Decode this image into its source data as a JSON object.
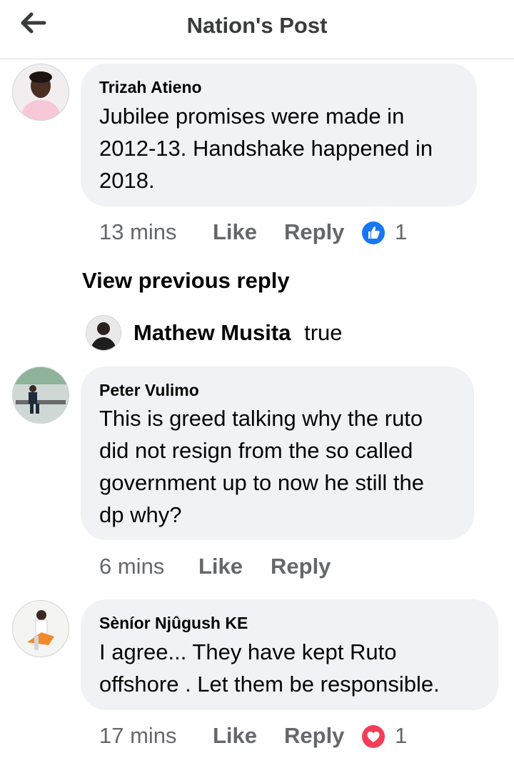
{
  "header": {
    "title": "Nation's Post",
    "back_icon": "arrow-left-icon"
  },
  "comments": [
    {
      "author": "Trizah Atieno",
      "lines": [
        "Jubilee promises were made in",
        "2012-13. Handshake happened in",
        "2018."
      ],
      "time": "13 mins",
      "like_label": "Like",
      "reply_label": "Reply",
      "reaction": {
        "icon": "thumbs-up-icon",
        "color": "#1877f2",
        "count": "1"
      },
      "avatar_icon": "profile-photo"
    },
    {
      "author": "Peter Vulimo",
      "lines": [
        "This is greed talking why the ruto",
        "did not resign from the so called",
        "government up to now he still the",
        "dp why?"
      ],
      "time": "6 mins",
      "like_label": "Like",
      "reply_label": "Reply",
      "avatar_icon": "profile-photo"
    },
    {
      "author": "Sèníor Njûgush KE",
      "lines": [
        "I agree... They have kept Ruto",
        "offshore . Let them be responsible."
      ],
      "time": "17 mins",
      "like_label": "Like",
      "reply_label": "Reply",
      "reaction": {
        "icon": "heart-icon",
        "color": "#f33e58",
        "count": "1"
      },
      "avatar_icon": "profile-photo"
    }
  ],
  "replies": {
    "view_previous_label": "View previous reply",
    "latest": {
      "author": "Mathew Musita",
      "text": "true"
    }
  },
  "colors": {
    "bubble": "#f0f2f5",
    "meta_text": "#65676b",
    "like_blue": "#1877f2",
    "love_red": "#f33e58"
  }
}
